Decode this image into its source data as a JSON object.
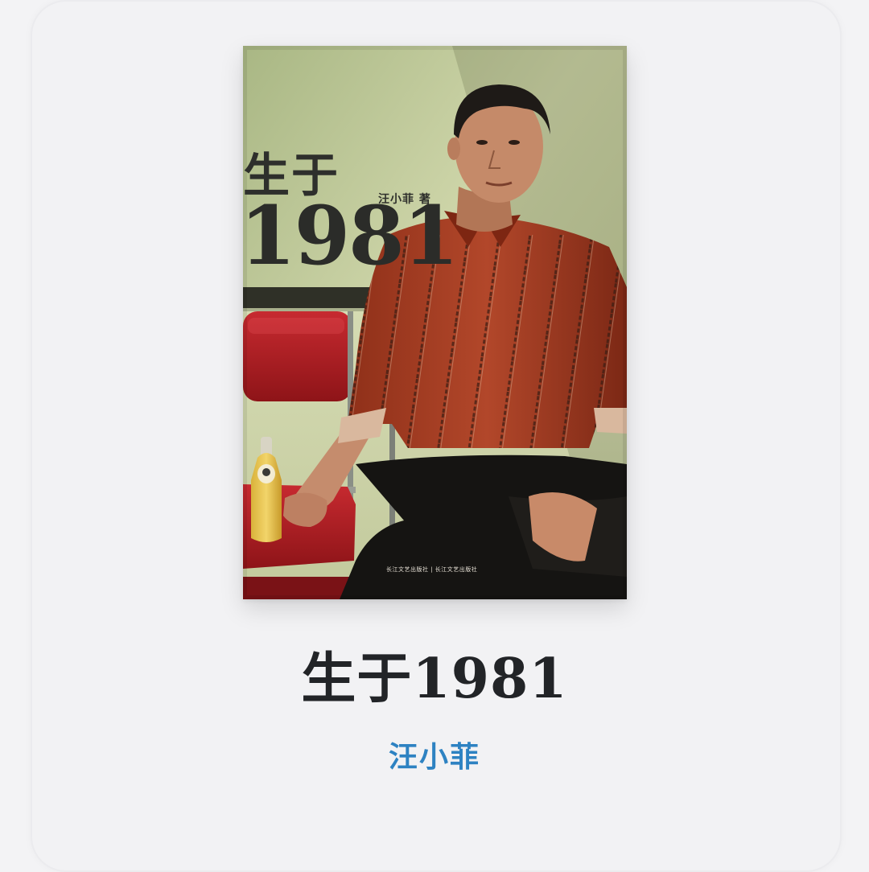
{
  "book": {
    "title": "生于1981",
    "author": "汪小菲"
  },
  "cover": {
    "title_line1": "生于",
    "title_line2": "1981",
    "author_credit": "汪小菲 著",
    "publisher_marks": "长江文艺出版社 | 长江文艺出版社"
  },
  "colors": {
    "page_background": "#f3f3f5",
    "title_color": "#222427",
    "author_link_color": "#2d82c2",
    "cover_wall_green": "#b9c597",
    "shirt_red": "#a23a20",
    "chair_red": "#b4232a"
  }
}
